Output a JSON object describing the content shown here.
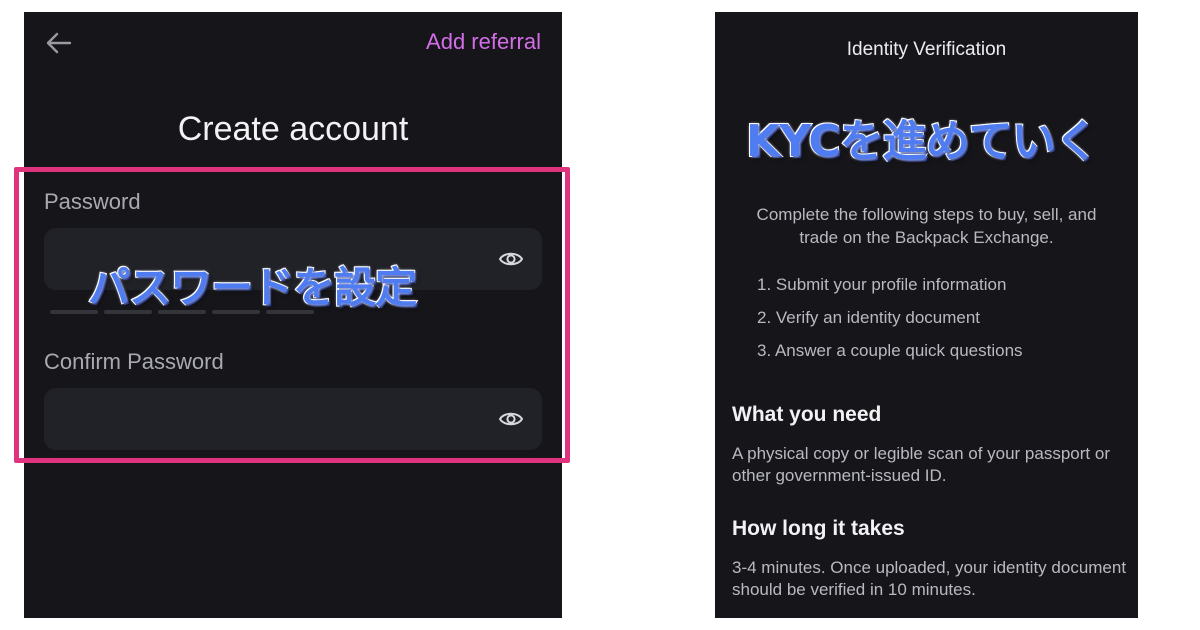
{
  "left_screen": {
    "back_icon": "arrow-left-icon",
    "referral_link": "Add referral",
    "title": "Create account",
    "password_label": "Password",
    "password_value": "",
    "confirm_label": "Confirm Password",
    "confirm_value": "",
    "eye_icon": "eye-icon",
    "annotation": "パスワードを設定",
    "colors": {
      "accent": "#d46ee8",
      "highlight": "#e0337e",
      "background": "#15151a",
      "field": "#212228"
    }
  },
  "right_screen": {
    "header": "Identity Verification",
    "annotation": "KYCを進めていく",
    "intro": "Complete the following steps to buy, sell, and trade on the Backpack Exchange.",
    "steps": [
      "1. Submit your profile information",
      "2. Verify an identity document",
      "3. Answer a couple quick questions"
    ],
    "need_heading": "What you need",
    "need_text": "A physical copy or legible scan of your passport or other government-issued ID.",
    "time_heading": "How long it takes",
    "time_text": "3-4 minutes. Once uploaded, your identity document should be verified in 10 minutes.",
    "colors": {
      "annotation": "#4f7cf0",
      "background": "#15151a"
    }
  }
}
